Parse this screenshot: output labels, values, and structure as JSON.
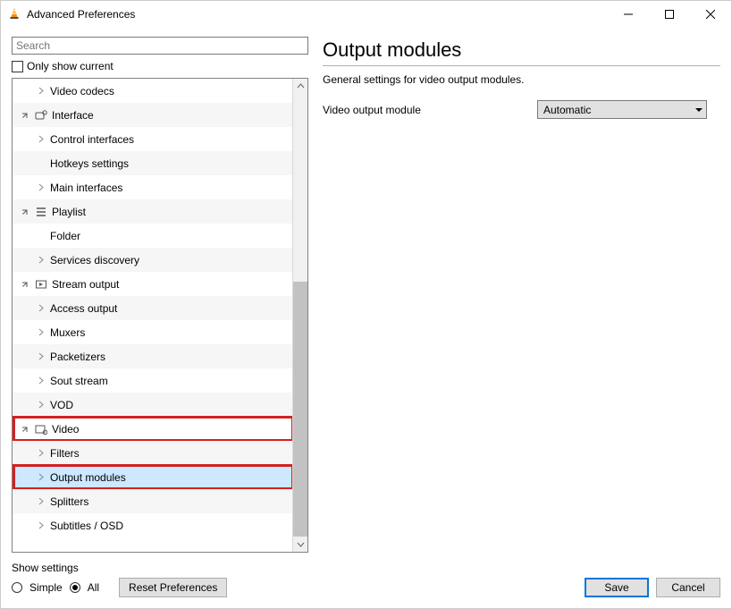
{
  "window": {
    "title": "Advanced Preferences"
  },
  "search": {
    "placeholder": "Search"
  },
  "only_show_current": "Only show current",
  "tree": [
    {
      "depth": 2,
      "expander": "leaf",
      "label": "Video codecs"
    },
    {
      "depth": 1,
      "expander": "open",
      "icon": "interface",
      "label": "Interface"
    },
    {
      "depth": 2,
      "expander": "leaf",
      "label": "Control interfaces"
    },
    {
      "depth": 2,
      "expander": "none",
      "label": "Hotkeys settings"
    },
    {
      "depth": 2,
      "expander": "leaf",
      "label": "Main interfaces"
    },
    {
      "depth": 1,
      "expander": "open",
      "icon": "playlist",
      "label": "Playlist"
    },
    {
      "depth": 2,
      "expander": "none",
      "label": "Folder"
    },
    {
      "depth": 2,
      "expander": "leaf",
      "label": "Services discovery"
    },
    {
      "depth": 1,
      "expander": "open",
      "icon": "stream",
      "label": "Stream output"
    },
    {
      "depth": 2,
      "expander": "leaf",
      "label": "Access output"
    },
    {
      "depth": 2,
      "expander": "leaf",
      "label": "Muxers"
    },
    {
      "depth": 2,
      "expander": "leaf",
      "label": "Packetizers"
    },
    {
      "depth": 2,
      "expander": "leaf",
      "label": "Sout stream"
    },
    {
      "depth": 2,
      "expander": "leaf",
      "label": "VOD"
    },
    {
      "depth": 1,
      "expander": "open",
      "icon": "video",
      "label": "Video",
      "highlight": true
    },
    {
      "depth": 2,
      "expander": "leaf",
      "label": "Filters"
    },
    {
      "depth": 2,
      "expander": "leaf",
      "label": "Output modules",
      "selected": true,
      "highlight": true
    },
    {
      "depth": 2,
      "expander": "leaf",
      "label": "Splitters"
    },
    {
      "depth": 2,
      "expander": "leaf",
      "label": "Subtitles / OSD"
    }
  ],
  "panel": {
    "title": "Output modules",
    "description": "General settings for video output modules.",
    "field_label": "Video output module",
    "field_value": "Automatic"
  },
  "footer": {
    "show_settings": "Show settings",
    "simple": "Simple",
    "all": "All",
    "reset": "Reset Preferences",
    "save": "Save",
    "cancel": "Cancel"
  }
}
